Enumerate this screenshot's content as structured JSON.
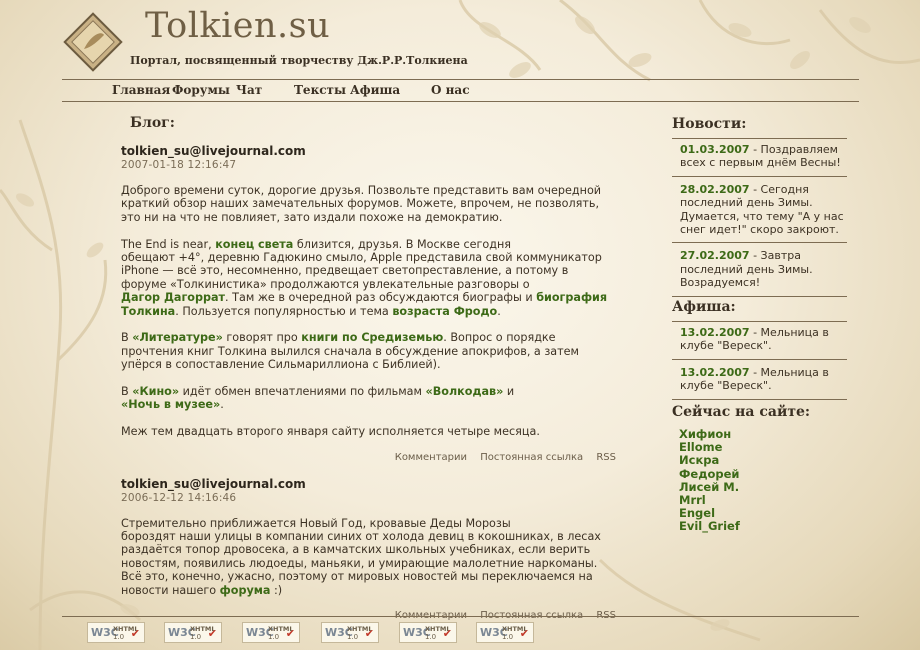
{
  "header": {
    "title": "Tolkien.su",
    "subtitle": "Портал, посвященный творчеству Дж.Р.Р.Толкиена"
  },
  "nav": [
    "Главная",
    "Форумы",
    "Чат",
    "Тексты",
    "Афиша",
    "О нас"
  ],
  "blog": {
    "heading": "Блог:",
    "posts": [
      {
        "author": "tolkien_su@livejournal.com",
        "date": "2007-01-18 12:16:47",
        "p1": [
          "Доброго времени суток, дорогие друзья. Позвольте представить вам очередной",
          "краткий обзор наших замечательных форумов. Можете, впрочем, не позволять,",
          "это ни на что не повлияет, зато издали похоже на демократию."
        ],
        "p2": {
          "t1": "The End is near, ",
          "l1": "конец света",
          "t2": " близится, друзья. В Москве сегодня",
          "t3": "обещают +4°, деревню Гадюкино смыло, Apple представила свой коммуникатор",
          "t4": "iPhone — всё это, несомненно, предвещает светопреставление, а потому в",
          "t5": "форуме «Толкинистика» продолжаются увлекательные разговоры о",
          "l2": "Дагор Дагоррат",
          "t6": ". Там же в очередной раз обсуждаются биографы и ",
          "l3": "биография",
          "l4": "Толкина",
          "t7": ". Пользуется популярностью и тема ",
          "l5": "возраста Фродо",
          "t8": "."
        },
        "p3": {
          "t1": "В ",
          "l1": "«Литературе»",
          "t2": " говорят про ",
          "l2": "книги по Средиземью",
          "t3": ". Вопрос о порядке",
          "t4": "прочтения книг Толкина вылился сначала в обсуждение апокрифов, а затем",
          "t5": "упёрся в сопоставление Сильмариллиона с Библией)."
        },
        "p4": {
          "t1": "В ",
          "l1": "«Кино»",
          "t2": " идёт обмен впечатлениями по фильмам ",
          "l2": "«Волкодав»",
          "t3": " и",
          "l3": "«Ночь в музее»",
          "t4": "."
        },
        "p5": "Меж тем двадцать второго января сайту исполняется четыре месяца."
      },
      {
        "author": "tolkien_su@livejournal.com",
        "date": "2006-12-12 14:16:46",
        "lines": [
          "Стремительно приближается Новый Год, кровавые Деды Морозы",
          "бороздят наши улицы в компании синих от холода девиц в кокошниках, в лесах",
          "раздаётся топор дровосека, а в камчатских школьных учебниках, если верить",
          "новостям, появились людоеды, маньяки, и умирающие малолетние наркоманы.",
          "Всё это, конечно, ужасно, поэтому от мировых новостей мы переключаемся на"
        ],
        "last_t1": "новости нашего ",
        "last_link": "форума",
        "last_t2": " :)"
      }
    ],
    "links": [
      "Комментарии",
      "Постоянная ссылка",
      "RSS"
    ]
  },
  "sidebar": {
    "news_heading": "Новости:",
    "news": [
      {
        "date": "01.03.2007",
        "line1": " - Поздравляем",
        "rest": [
          "всех с первым днём Весны!"
        ]
      },
      {
        "date": "28.02.2007",
        "line1": " - Сегодня",
        "rest": [
          "последний день Зимы.",
          "Думается, что тему \"А у нас",
          "снег идет!\" скоро закроют."
        ]
      },
      {
        "date": "27.02.2007",
        "line1": " - Завтра",
        "rest": [
          "последний день Зимы.",
          "Возрадуемся!"
        ]
      }
    ],
    "afisha_heading": "Афиша:",
    "afisha": [
      {
        "date": "13.02.2007",
        "line1": " - Мельница в",
        "rest": [
          "клубе \"Вереск\"."
        ]
      },
      {
        "date": "13.02.2007",
        "line1": " - Мельница в",
        "rest": [
          "клубе \"Вереск\"."
        ]
      }
    ],
    "online_heading": "Сейчас на сайте:",
    "online": [
      "Хифион",
      "Ellome",
      "Искра",
      "Федорей",
      "Лисей М.",
      "Mrrl",
      "Engel",
      "Evil_Grief"
    ]
  },
  "footer": {
    "badge_w3c": "W3C",
    "badge_xhtml": "XHTML",
    "badge_version": "1.0",
    "badge_count": 6
  },
  "colors": {
    "link_green": "#3d6a17",
    "text": "#3d3224",
    "rule": "#7d6c52"
  }
}
